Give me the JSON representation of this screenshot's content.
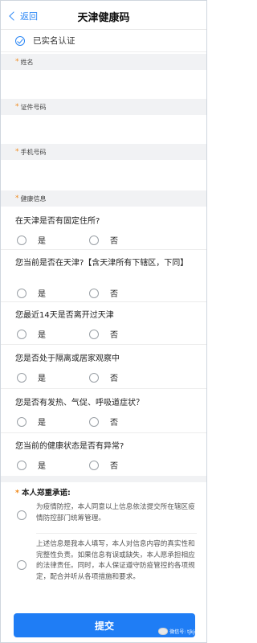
{
  "header": {
    "back_label": "返回",
    "title": "天津健康码"
  },
  "verified": {
    "text": "已实名认证"
  },
  "fields": {
    "name": {
      "star": "*",
      "label": "姓名",
      "value": ""
    },
    "id_number": {
      "star": "*",
      "label": "证件号码",
      "value": ""
    },
    "phone": {
      "star": "*",
      "label": "手机号码",
      "value": ""
    },
    "health": {
      "star": "*",
      "label": "健康信息"
    }
  },
  "questions": [
    {
      "text": "在天津是否有固定住所?",
      "yes": "是",
      "no": "否"
    },
    {
      "text": "您当前是否在天津?【含天津所有下辖区，下同】",
      "yes": "是",
      "no": "否"
    },
    {
      "text": "您最近14天是否离开过天津",
      "yes": "是",
      "no": "否"
    },
    {
      "text": "您是否处于隔离或居家观察中",
      "yes": "是",
      "no": "否"
    },
    {
      "text": "您是否有发热、气促、呼吸道症状？",
      "yes": "是",
      "no": "否"
    },
    {
      "text": "您当前的健康状态是否有异常?",
      "yes": "是",
      "no": "否"
    }
  ],
  "commitment": {
    "star": "*",
    "title": "本人郑重承诺:",
    "items": [
      "为疫情防控，本人同意以上信息依法提交所在辖区疫情防控部门统筹管理。",
      "上述信息是我本人填写，本人对信息内容的真实性和完整性负责。如果信息有误或缺失，本人愿承担相应的法律责任。同时，本人保证遵守防疫管控的各项规定，配合并听从各项措施和要求。"
    ]
  },
  "submit": {
    "label": "提交"
  },
  "watermark": {
    "text": "微信号: tjkjdw"
  },
  "colors": {
    "accent": "#1f7df5",
    "star": "#f08a1d",
    "label_bar": "#f1f2f4"
  }
}
